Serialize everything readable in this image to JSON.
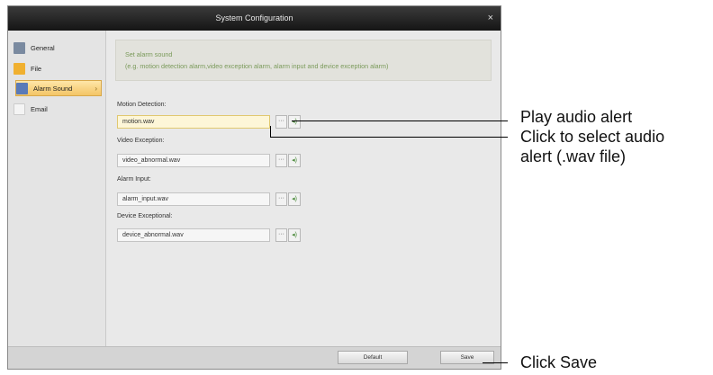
{
  "window": {
    "title": "System Configuration",
    "close_icon": "×"
  },
  "sidebar": {
    "items": [
      {
        "label": "General",
        "icon": "general-icon",
        "color": "#7a8aa0"
      },
      {
        "label": "File",
        "icon": "folder-icon",
        "color": "#f0b030"
      },
      {
        "label": "Alarm Sound",
        "icon": "alarm-sound-icon",
        "color": "#5a7ab8",
        "active": true,
        "chevron": "›"
      },
      {
        "label": "Email",
        "icon": "email-icon",
        "color": "#f4f4f4"
      }
    ]
  },
  "hint": {
    "line1": "Set alarm sound",
    "line2": "(e.g. motion detection alarm,video exception alarm, alarm input and device exception alarm)"
  },
  "fields": [
    {
      "label": "Motion Detection:",
      "value": "motion.wav"
    },
    {
      "label": "Video Exception:",
      "value": "video_abnormal.wav"
    },
    {
      "label": "Alarm Input:",
      "value": "alarm_input.wav"
    },
    {
      "label": "Device Exceptional:",
      "value": "device_abnormal.wav"
    }
  ],
  "buttons": {
    "browse_glyph": "···",
    "play_glyph": "◂)",
    "default": "Default",
    "save": "Save"
  },
  "callouts": {
    "play": "Play audio alert",
    "select_1": "Click to select audio",
    "select_2": "alert (.wav file)",
    "save": "Click Save"
  },
  "colors": {
    "accent": "#f3c566",
    "hint_text": "#7a9a5a",
    "titlebar": "#1e1e1e"
  }
}
